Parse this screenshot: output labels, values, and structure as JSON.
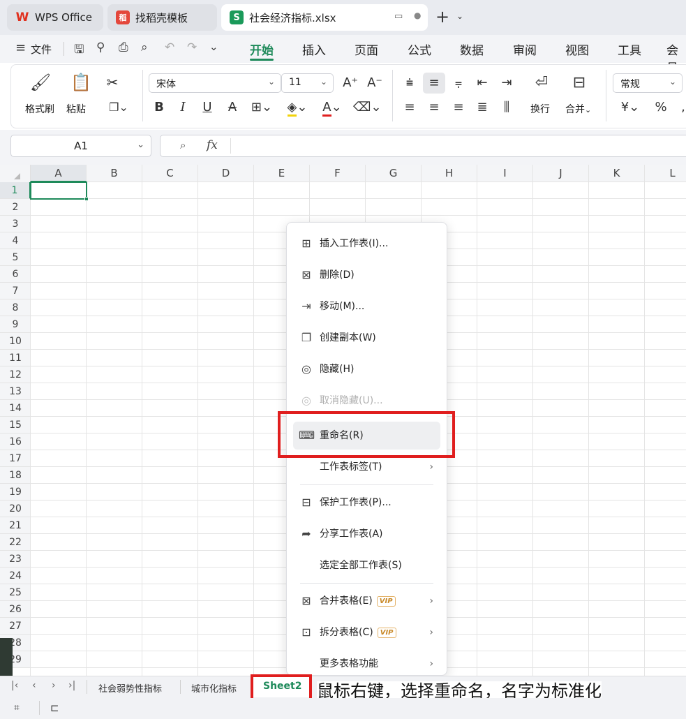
{
  "titlebar": {
    "tabs": [
      {
        "label": "WPS Office",
        "logo": "W"
      },
      {
        "label": "找稻壳模板",
        "logo": "稻"
      },
      {
        "label": "社会经济指标.xlsx",
        "logo": "S"
      }
    ],
    "new_tab": "+"
  },
  "menubar": {
    "file": "文件",
    "tabs": [
      "开始",
      "插入",
      "页面",
      "公式",
      "数据",
      "审阅",
      "视图",
      "工具",
      "会员"
    ]
  },
  "ribbon": {
    "format_painter": "格式刷",
    "paste": "粘贴",
    "font_name": "宋体",
    "font_size": "11",
    "wrap": "换行",
    "merge": "合并",
    "number_format": "常规",
    "currency": "¥",
    "percent": "%"
  },
  "formula_bar": {
    "name_box": "A1",
    "fx": "fx",
    "value": ""
  },
  "grid": {
    "columns": [
      "A",
      "B",
      "C",
      "D",
      "E",
      "F",
      "G",
      "H",
      "I",
      "J",
      "K",
      "L"
    ],
    "rows": [
      "1",
      "2",
      "3",
      "4",
      "5",
      "6",
      "7",
      "8",
      "9",
      "10",
      "11",
      "12",
      "13",
      "14",
      "15",
      "16",
      "17",
      "18",
      "19",
      "20",
      "21",
      "22",
      "23",
      "24",
      "25",
      "26",
      "27",
      "28",
      "29"
    ]
  },
  "context_menu": {
    "items": [
      {
        "label": "插入工作表(I)...",
        "icon": "insert-sheet-icon",
        "glyph": "⊞",
        "disabled": false,
        "arrow": false
      },
      {
        "label": "删除(D)",
        "icon": "delete-sheet-icon",
        "glyph": "⊠",
        "disabled": false,
        "arrow": false
      },
      {
        "label": "移动(M)...",
        "icon": "move-sheet-icon",
        "glyph": "⇥",
        "disabled": false,
        "arrow": false
      },
      {
        "label": "创建副本(W)",
        "icon": "copy-sheet-icon",
        "glyph": "❐",
        "disabled": false,
        "arrow": false
      },
      {
        "label": "隐藏(H)",
        "icon": "hide-icon",
        "glyph": "◎",
        "disabled": false,
        "arrow": false
      },
      {
        "label": "取消隐藏(U)...",
        "icon": "unhide-icon",
        "glyph": "◎",
        "disabled": true,
        "arrow": false
      },
      {
        "label": "重命名(R)",
        "icon": "rename-icon",
        "glyph": "⌨",
        "disabled": false,
        "arrow": false,
        "highlight": true
      },
      {
        "label": "工作表标签(T)",
        "icon": "",
        "glyph": "",
        "disabled": false,
        "arrow": true
      },
      {
        "label": "保护工作表(P)...",
        "icon": "protect-sheet-icon",
        "glyph": "⊟",
        "disabled": false,
        "arrow": false
      },
      {
        "label": "分享工作表(A)",
        "icon": "share-icon",
        "glyph": "➦",
        "disabled": false,
        "arrow": false
      },
      {
        "label": "选定全部工作表(S)",
        "icon": "",
        "glyph": "",
        "disabled": false,
        "arrow": false
      },
      {
        "label": "合并表格(E)",
        "icon": "merge-tables-icon",
        "glyph": "⊠",
        "disabled": false,
        "arrow": true,
        "vip": "VIP"
      },
      {
        "label": "拆分表格(C)",
        "icon": "split-tables-icon",
        "glyph": "⊡",
        "disabled": false,
        "arrow": true,
        "vip": "VIP"
      },
      {
        "label": "更多表格功能",
        "icon": "",
        "glyph": "",
        "disabled": false,
        "arrow": true
      }
    ]
  },
  "sheet_tabs": [
    "社会弱势性指标",
    "城市化指标",
    "Sheet2"
  ],
  "annotation": "鼠标右键，选择重命名，名字为标准化",
  "colors": {
    "accent": "#1e8a5a",
    "highlight_box": "#e01e1e"
  }
}
